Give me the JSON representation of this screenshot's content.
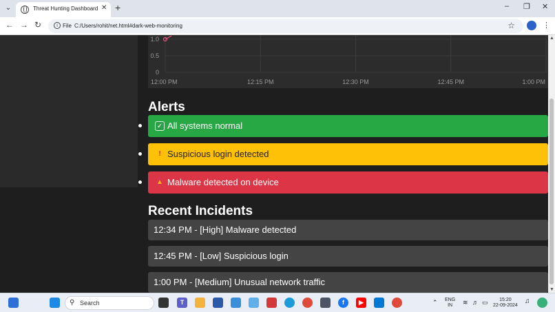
{
  "browser": {
    "tab_title": "Threat Hunting Dashboard",
    "omnibox_scheme": "File",
    "url": "C:/Users/rohit/net.html#dark-web-monitoring"
  },
  "chart_data": {
    "type": "line",
    "y_ticks": [
      "1.0",
      "0.5",
      "0"
    ],
    "x_ticks": [
      "12:00 PM",
      "12:15 PM",
      "12:30 PM",
      "12:45 PM",
      "1:00 PM"
    ],
    "ylim": [
      0,
      1.0
    ],
    "series": [
      {
        "color": "#e0567a",
        "x": [
          "12:00 PM"
        ],
        "values": [
          1.0
        ]
      }
    ],
    "grid": true
  },
  "alerts": {
    "title": "Alerts",
    "items": [
      {
        "icon": "check-icon",
        "text": "All systems normal",
        "color": "#28a745"
      },
      {
        "icon": "exclamation-icon",
        "text": "Suspicious login detected",
        "color": "#ffc107"
      },
      {
        "icon": "fire-icon",
        "text": "Malware detected on device",
        "color": "#dc3545"
      }
    ]
  },
  "incidents": {
    "title": "Recent Incidents",
    "items": [
      "12:34 PM - [High] Malware detected",
      "12:45 PM - [Low] Suspicious login",
      "1:00 PM - [Medium] Unusual network traffic"
    ]
  },
  "taskbar": {
    "search_label": "Search",
    "lang_line1": "ENG",
    "lang_line2": "IN",
    "time": "15:20",
    "date": "22-09-2024"
  }
}
